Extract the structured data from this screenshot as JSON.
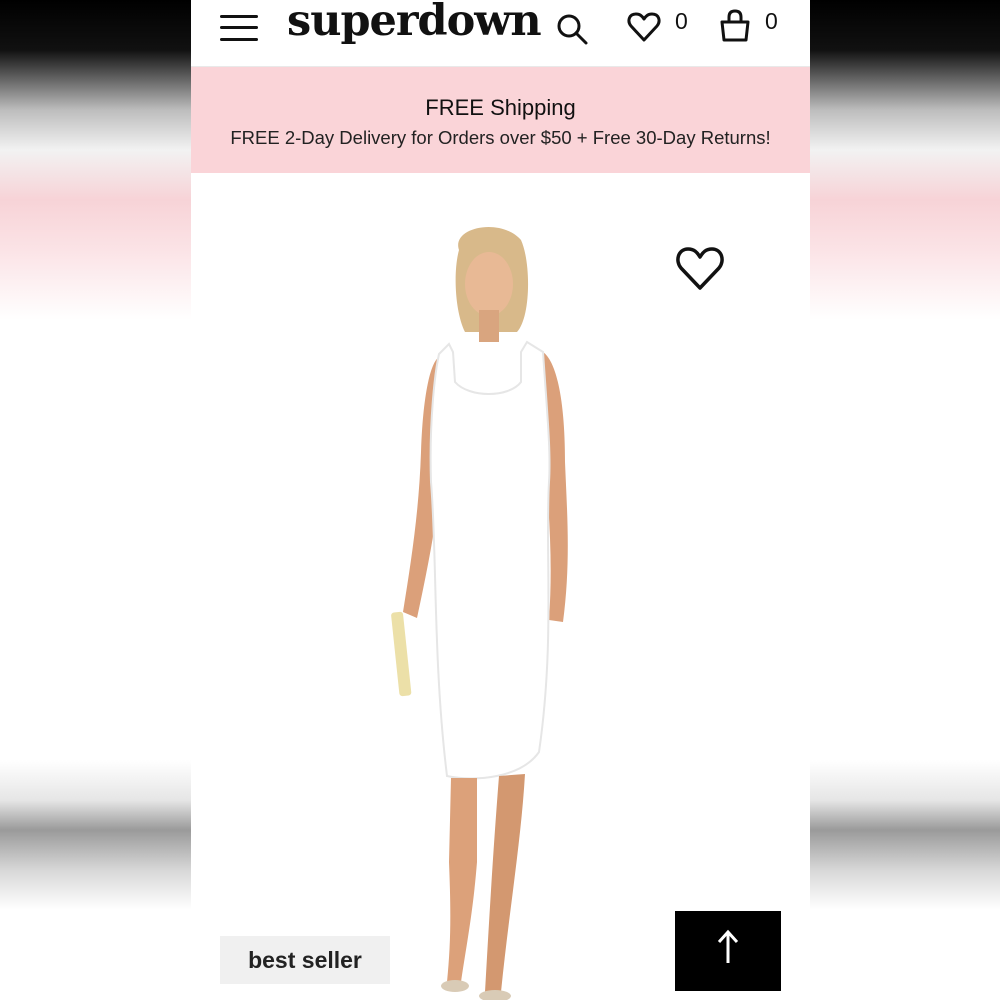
{
  "header": {
    "logo_text": "superdown",
    "wishlist_count": "0",
    "bag_count": "0",
    "icons": [
      "menu-icon",
      "search-icon",
      "heart-icon",
      "shopping-bag-icon"
    ]
  },
  "promo": {
    "title": "FREE Shipping",
    "subtitle": "FREE 2-Day Delivery for Orders over $50 + Free 30-Day Returns!",
    "background_color": "#fad4d8"
  },
  "product": {
    "badge": "best seller",
    "favorite_icon": "heart-icon",
    "scroll_top_icon": "arrow-up-icon"
  }
}
